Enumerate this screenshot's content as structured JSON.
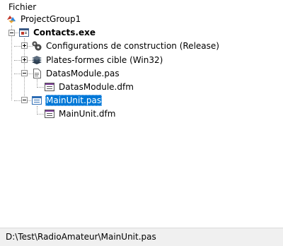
{
  "header": {
    "title": "Fichier"
  },
  "tree": {
    "group": "ProjectGroup1",
    "project": "Contacts.exe",
    "build_configs": "Configurations de construction (Release)",
    "platforms": "Plates-formes cible (Win32)",
    "datas_module_pas": "DatasModule.pas",
    "datas_module_dfm": "DatasModule.dfm",
    "main_unit_pas": "MainUnit.pas",
    "main_unit_dfm": "MainUnit.dfm"
  },
  "status": {
    "path": "D:\\Test\\RadioAmateur\\MainUnit.pas"
  },
  "colors": {
    "selection": "#0078d7",
    "status_bg": "#f0f0f0"
  }
}
